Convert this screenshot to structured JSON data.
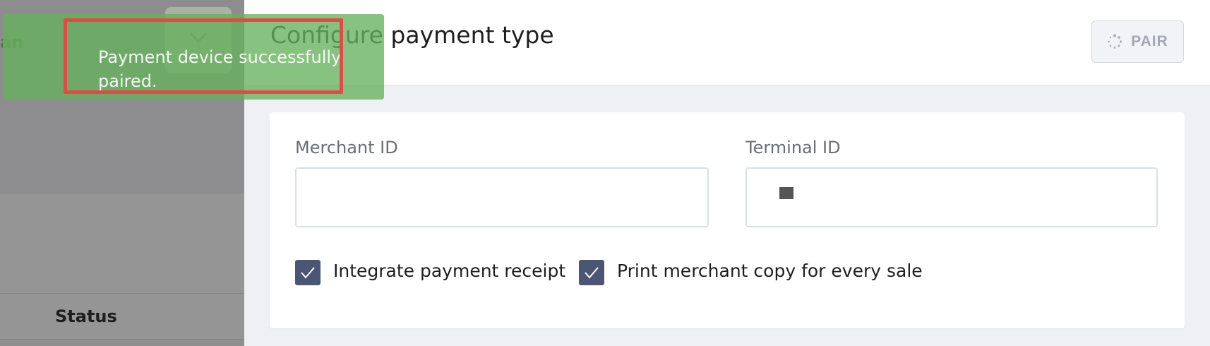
{
  "background": {
    "title_fragment": "an",
    "status_header": "Status"
  },
  "drawer": {
    "title": "Configure payment type",
    "pair_button": "PAIR"
  },
  "form": {
    "merchant_id_label": "Merchant ID",
    "merchant_id_value": "",
    "terminal_id_label": "Terminal ID",
    "terminal_id_value": "",
    "checkbox_receipt_label": "Integrate payment receipt",
    "checkbox_receipt_checked": true,
    "checkbox_merchant_copy_label": "Print merchant copy for every sale",
    "checkbox_merchant_copy_checked": true
  },
  "toast": {
    "message": "Payment device successfully paired."
  },
  "colors": {
    "toast_bg": "#66b15c",
    "highlight": "#e44848",
    "checkbox": "#4b5675"
  }
}
